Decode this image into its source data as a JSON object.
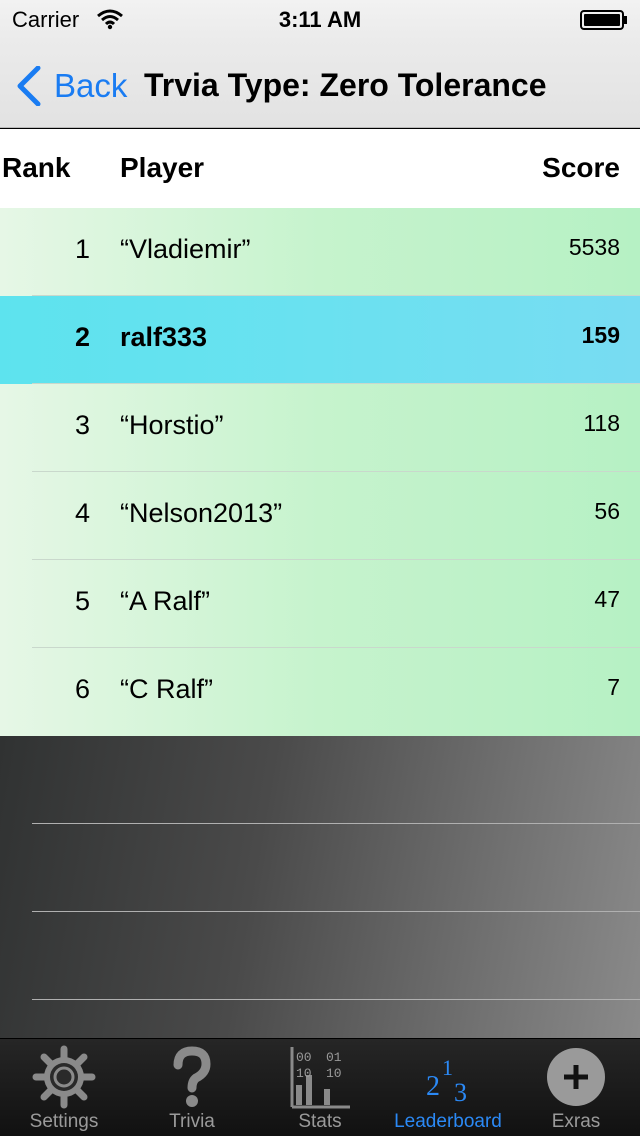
{
  "status_bar": {
    "carrier": "Carrier",
    "time": "3:11 AM"
  },
  "nav": {
    "back_label": "Back",
    "title": "Trvia Type: Zero Tolerance"
  },
  "table": {
    "headers": {
      "rank": "Rank",
      "player": "Player",
      "score": "Score"
    },
    "rows": [
      {
        "rank": "1",
        "player": "“Vladiemir”",
        "score": "5538"
      },
      {
        "rank": "2",
        "player": "ralf333",
        "score": "159"
      },
      {
        "rank": "3",
        "player": "“Horstio”",
        "score": "118"
      },
      {
        "rank": "4",
        "player": "“Nelson2013”",
        "score": "56"
      },
      {
        "rank": "5",
        "player": "“A Ralf”",
        "score": "47"
      },
      {
        "rank": "6",
        "player": "“C Ralf”",
        "score": "7"
      }
    ],
    "selected_index": 1
  },
  "stats_icon_text": {
    "a": "00",
    "b": "01",
    "c": "10",
    "d": "10"
  },
  "leaderboard_icon_text": {
    "first": "1",
    "second": "2",
    "third": "3"
  },
  "tabs": [
    {
      "label": "Settings",
      "icon": "gear-icon"
    },
    {
      "label": "Trivia",
      "icon": "question-mark-icon"
    },
    {
      "label": "Stats",
      "icon": "stats-icon"
    },
    {
      "label": "Leaderboard",
      "icon": "leaderboard-icon",
      "active": true
    },
    {
      "label": "Exras",
      "icon": "plus-circle-icon"
    }
  ],
  "colors": {
    "accent": "#1a7cf2",
    "selected_row": "#6ae1f0",
    "row_green": "#c6f3cd",
    "tab_active": "#2b89f5"
  }
}
